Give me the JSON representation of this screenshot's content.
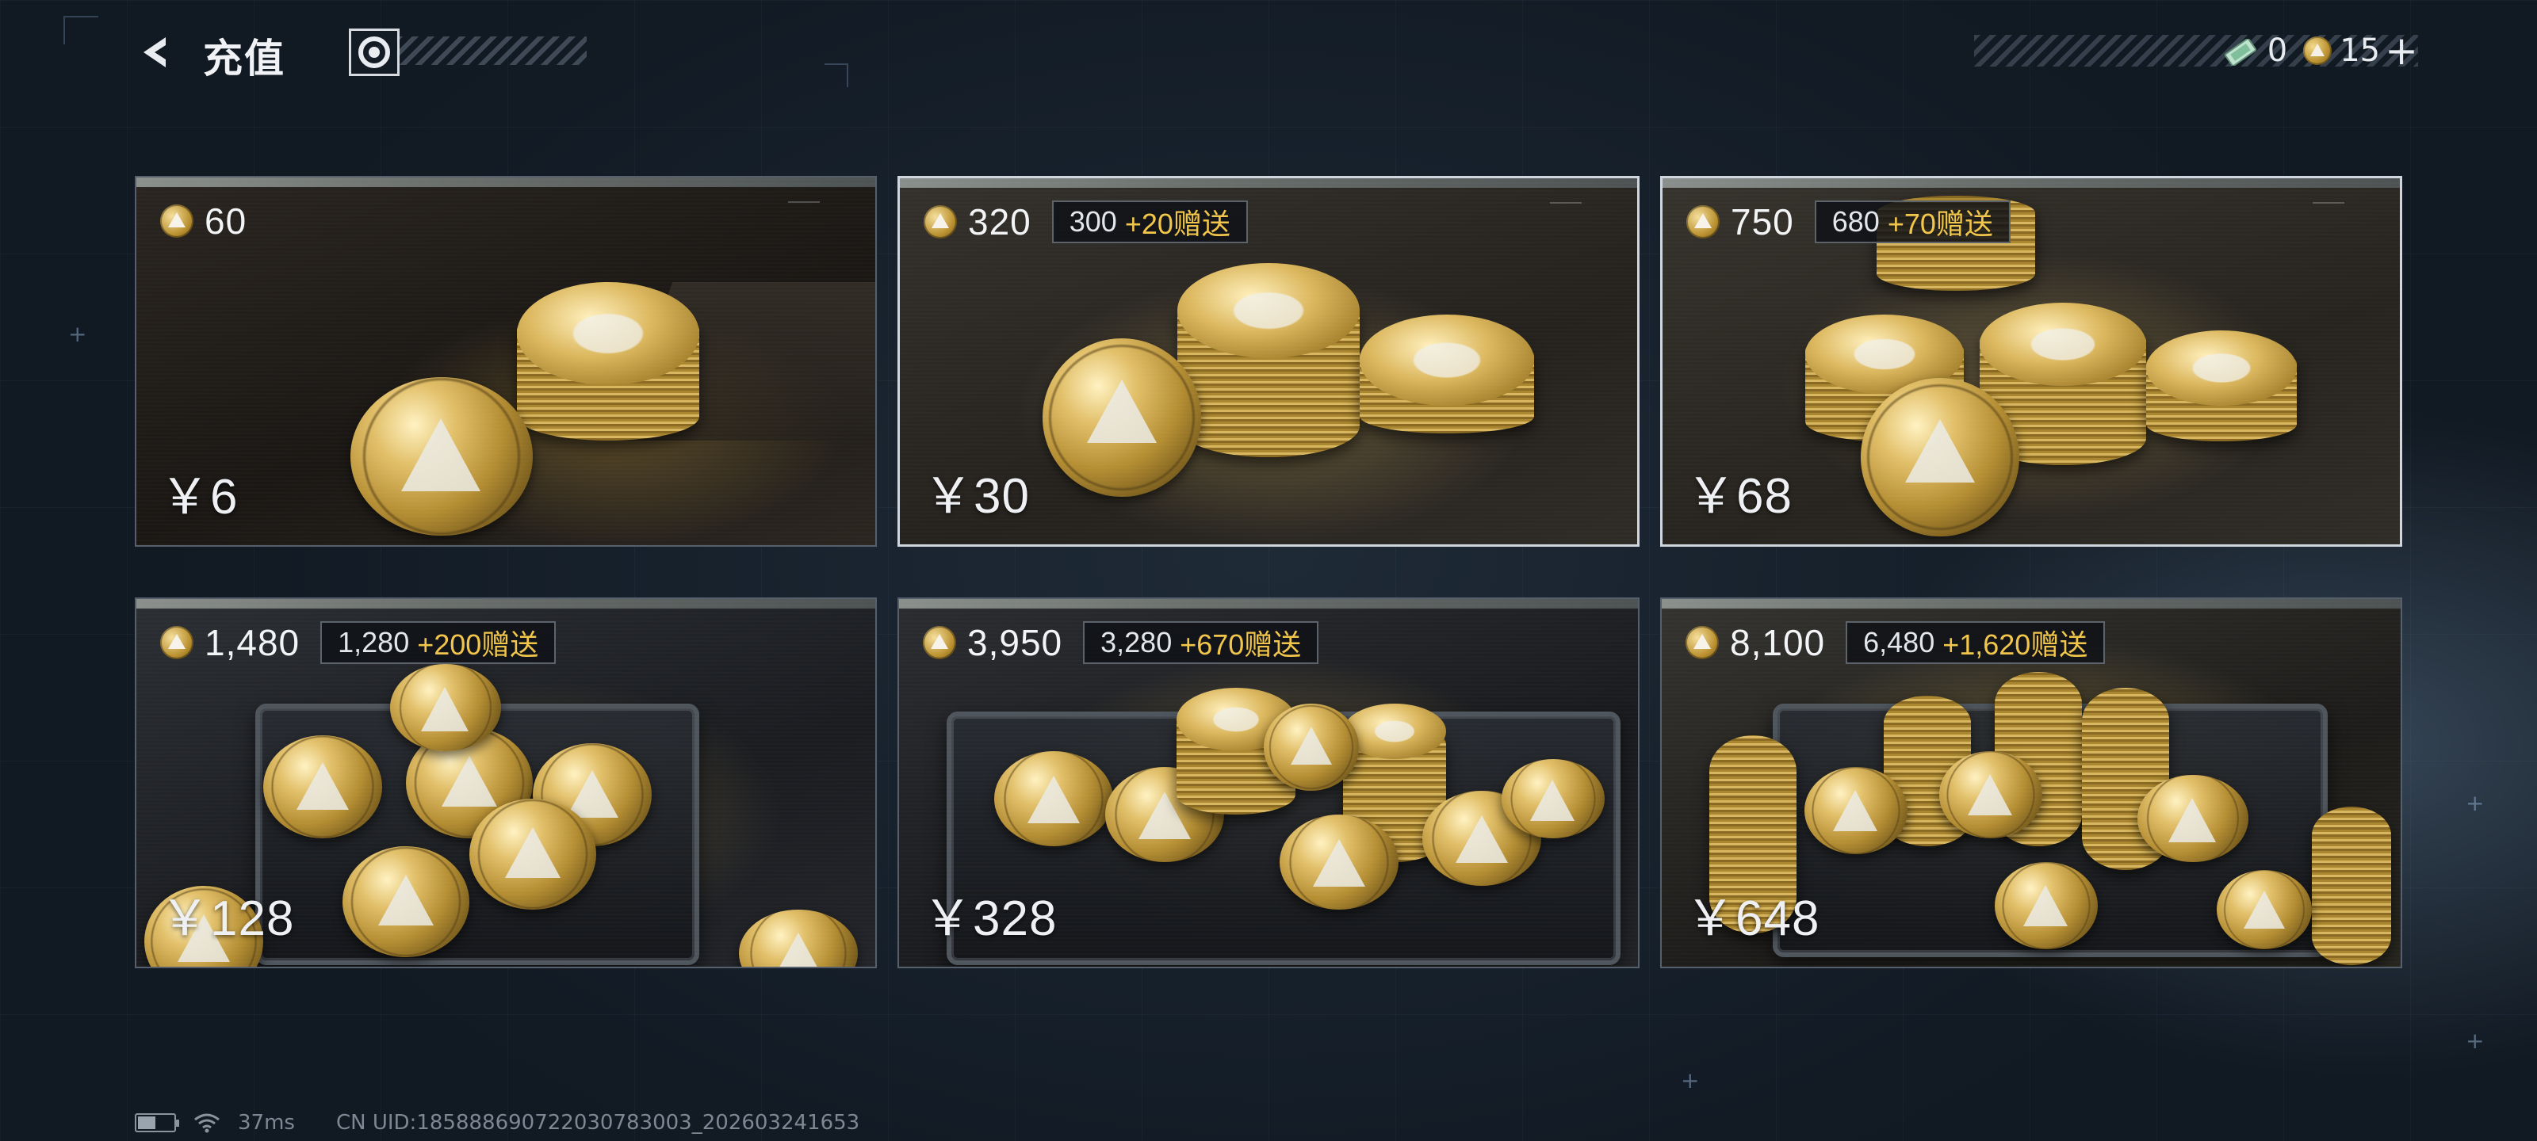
{
  "header": {
    "title": "充值",
    "back_icon": "chevron-left-icon",
    "logo_icon": "game-logo-icon"
  },
  "currencies": [
    {
      "icon": "ticket-icon",
      "value": "0"
    },
    {
      "icon": "coin-icon",
      "value": "15"
    }
  ],
  "add_label": "+",
  "products": [
    {
      "amount": "60",
      "base": "",
      "bonus": "",
      "price": "￥6"
    },
    {
      "amount": "320",
      "base": "300",
      "bonus": "+20赠送",
      "price": "￥30"
    },
    {
      "amount": "750",
      "base": "680",
      "bonus": "+70赠送",
      "price": "￥68"
    },
    {
      "amount": "1,480",
      "base": "1,280",
      "bonus": "+200赠送",
      "price": "￥128"
    },
    {
      "amount": "3,950",
      "base": "3,280",
      "bonus": "+670赠送",
      "price": "￥328"
    },
    {
      "amount": "8,100",
      "base": "6,480",
      "bonus": "+1,620赠送",
      "price": "￥648"
    }
  ],
  "footer": {
    "battery_level": 0.55,
    "ping": "37ms",
    "uid": "CN UID:185888690722030783003_202603241653"
  },
  "colors": {
    "bonus_accent": "#f2c64b",
    "background": "#16202b"
  }
}
